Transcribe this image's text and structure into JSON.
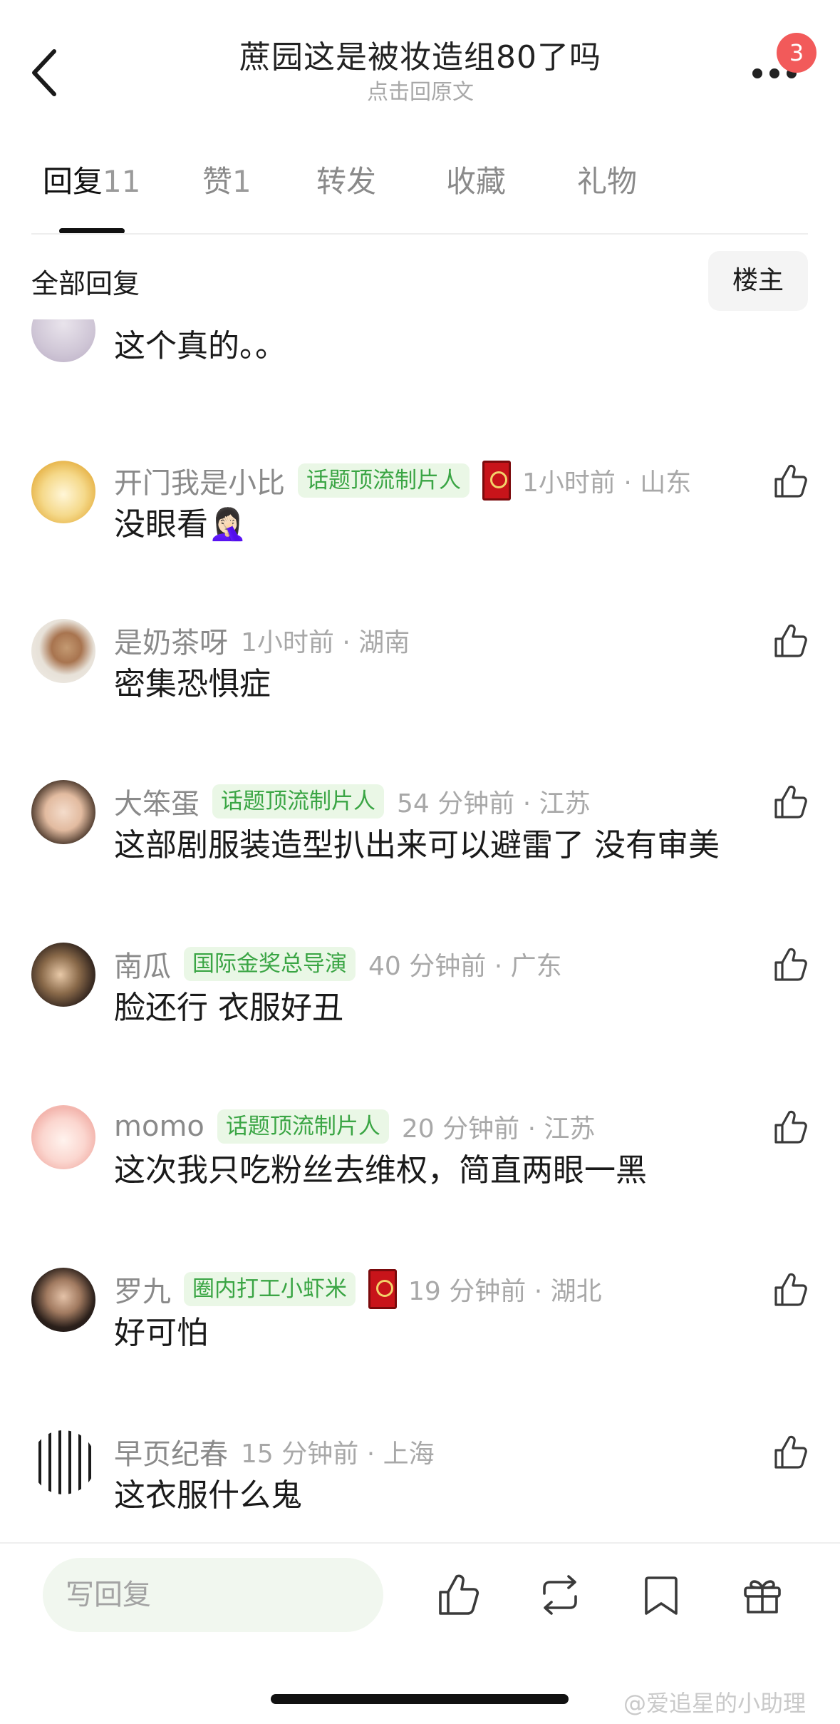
{
  "header": {
    "title": "蔗园这是被妆造组80了吗",
    "subtitle": "点击回原文",
    "badge_count": "3"
  },
  "tabs": [
    {
      "label": "回复",
      "count": "11",
      "active": true
    },
    {
      "label": "赞",
      "count": "1",
      "active": false
    },
    {
      "label": "转发",
      "count": "",
      "active": false
    },
    {
      "label": "收藏",
      "count": "",
      "active": false
    },
    {
      "label": "礼物",
      "count": "",
      "active": false
    }
  ],
  "section": {
    "title": "全部回复",
    "owner_filter": "楼主"
  },
  "partial_comment": {
    "content": "这个真的。。"
  },
  "comments": [
    {
      "username": "开门我是小比",
      "tag": "话题顶流制片人",
      "redbox": true,
      "time": "1小时前 · 山东",
      "content": "没眼看🤦🏻‍♀️"
    },
    {
      "username": "是奶茶呀",
      "tag": "",
      "redbox": false,
      "time": "1小时前 · 湖南",
      "content": "密集恐惧症"
    },
    {
      "username": "大笨蛋",
      "tag": "话题顶流制片人",
      "redbox": false,
      "time": "54 分钟前 · 江苏",
      "content": "这部剧服装造型扒出来可以避雷了 没有审美"
    },
    {
      "username": "南瓜",
      "tag": "国际金奖总导演",
      "redbox": false,
      "time": "40 分钟前 · 广东",
      "content": "脸还行 衣服好丑"
    },
    {
      "username": "momo",
      "tag": "话题顶流制片人",
      "redbox": false,
      "time": "20 分钟前 · 江苏",
      "content": "这次我只吃粉丝去维权，简直两眼一黑"
    },
    {
      "username": "罗九",
      "tag": "圈内打工小虾米",
      "redbox": true,
      "time": "19 分钟前 · 湖北",
      "content": "好可怕"
    },
    {
      "username": "早页纪春",
      "tag": "",
      "redbox": false,
      "time": "15 分钟前 · 上海",
      "content": "这衣服什么鬼"
    }
  ],
  "bottom_bar": {
    "reply_placeholder": "写回复"
  },
  "watermark": "@爱追星的小助理",
  "colors": {
    "tag_green": "#3aa544",
    "tag_bg": "#eaf7e6",
    "badge_red": "#f25a5a",
    "muted_gray": "#a8a8a8"
  },
  "icons": [
    "back-arrow-icon",
    "more-dots-icon",
    "thumbs-up-icon",
    "repost-icon",
    "bookmark-icon",
    "gift-icon"
  ]
}
